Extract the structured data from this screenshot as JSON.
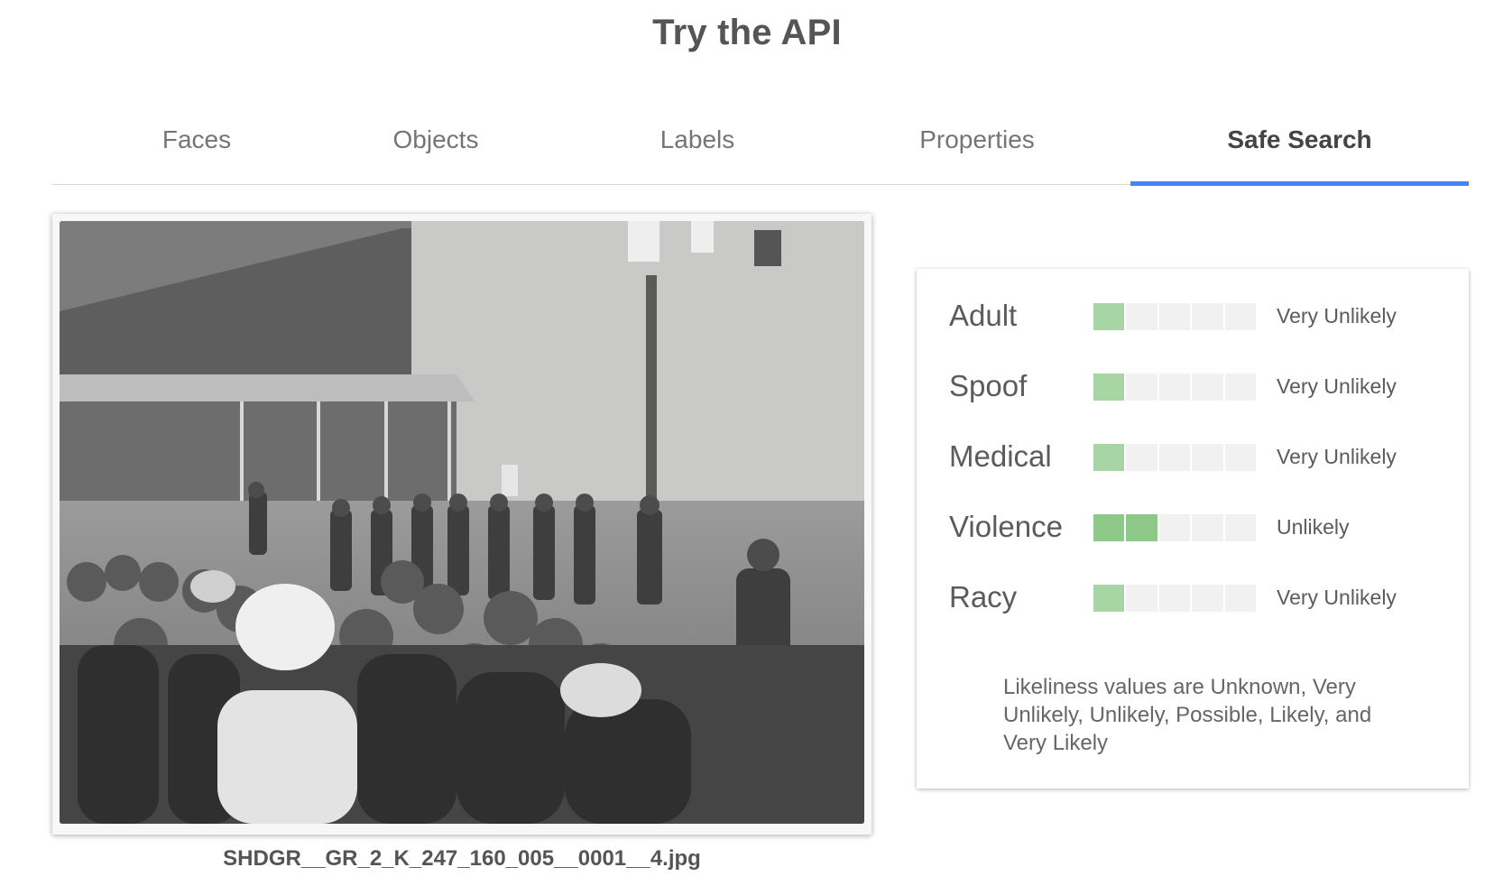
{
  "page": {
    "title": "Try the API"
  },
  "tabs": [
    {
      "label": "Faces",
      "active": false
    },
    {
      "label": "Objects",
      "active": false
    },
    {
      "label": "Labels",
      "active": false
    },
    {
      "label": "Properties",
      "active": false
    },
    {
      "label": "Safe Search",
      "active": true
    }
  ],
  "image": {
    "filename": "SHDGR__GR_2_K_247_160_005__0001__4.jpg"
  },
  "safe_search": {
    "scale_segments": 5,
    "colors": {
      "filled_light": "#a8d5a4",
      "filled_dark": "#8fc98a",
      "empty": "#f1f1f1",
      "tab_indicator": "#4285f4"
    },
    "rows": [
      {
        "category": "Adult",
        "likelihood": "Very Unlikely",
        "level": 1
      },
      {
        "category": "Spoof",
        "likelihood": "Very Unlikely",
        "level": 1
      },
      {
        "category": "Medical",
        "likelihood": "Very Unlikely",
        "level": 1
      },
      {
        "category": "Violence",
        "likelihood": "Unlikely",
        "level": 2
      },
      {
        "category": "Racy",
        "likelihood": "Very Unlikely",
        "level": 1
      }
    ],
    "note": "Likeliness values are Unknown, Very Unlikely, Unlikely, Possible, Likely, and Very Likely"
  }
}
